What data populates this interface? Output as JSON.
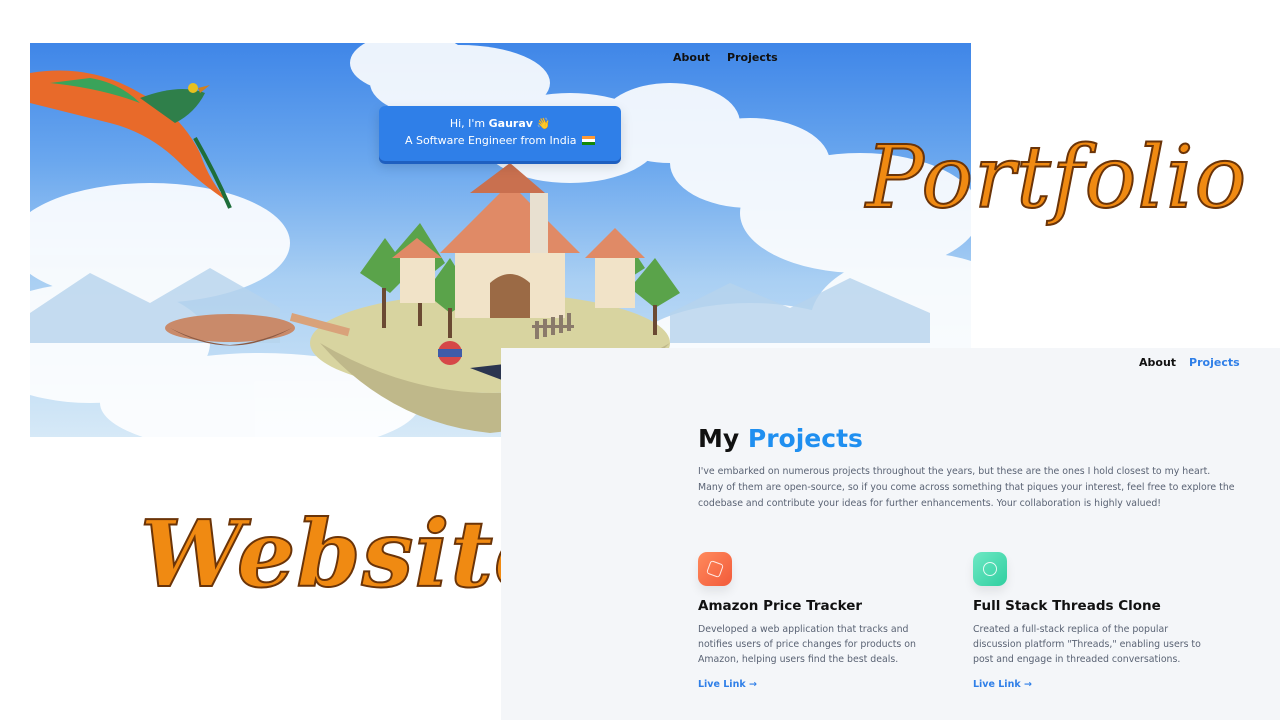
{
  "hero": {
    "nav": {
      "about": "About",
      "projects": "Projects"
    },
    "greeting_prefix": "Hi, I'm",
    "name": "Gaurav",
    "wave_emoji": "👋",
    "tagline": "A Software Engineer from India",
    "flag": "india-flag"
  },
  "overlay": {
    "portfolio_text": "Portfolio",
    "website_text": "Website",
    "art_color": "#f08a12"
  },
  "projects_page": {
    "nav": {
      "about": "About",
      "projects": "Projects"
    },
    "title_prefix": "My",
    "title_accent": "Projects",
    "accent_color": "#1f8ff0",
    "intro": "I've embarked on numerous projects throughout the years, but these are the ones I hold closest to my heart. Many of them are open-source, so if you come across something that piques your interest, feel free to explore the codebase and contribute your ideas for further enhancements. Your collaboration is highly valued!",
    "cards": [
      {
        "icon": "price-tag-icon",
        "title": "Amazon Price Tracker",
        "description": "Developed a web application that tracks and notifies users of price changes for products on Amazon, helping users find the best deals.",
        "link_label": "Live Link",
        "link_arrow": "→"
      },
      {
        "icon": "threads-icon",
        "title": "Full Stack Threads Clone",
        "description": "Created a full-stack replica of the popular discussion platform \"Threads,\" enabling users to post and engage in threaded conversations.",
        "link_label": "Live Link",
        "link_arrow": "→"
      }
    ]
  }
}
